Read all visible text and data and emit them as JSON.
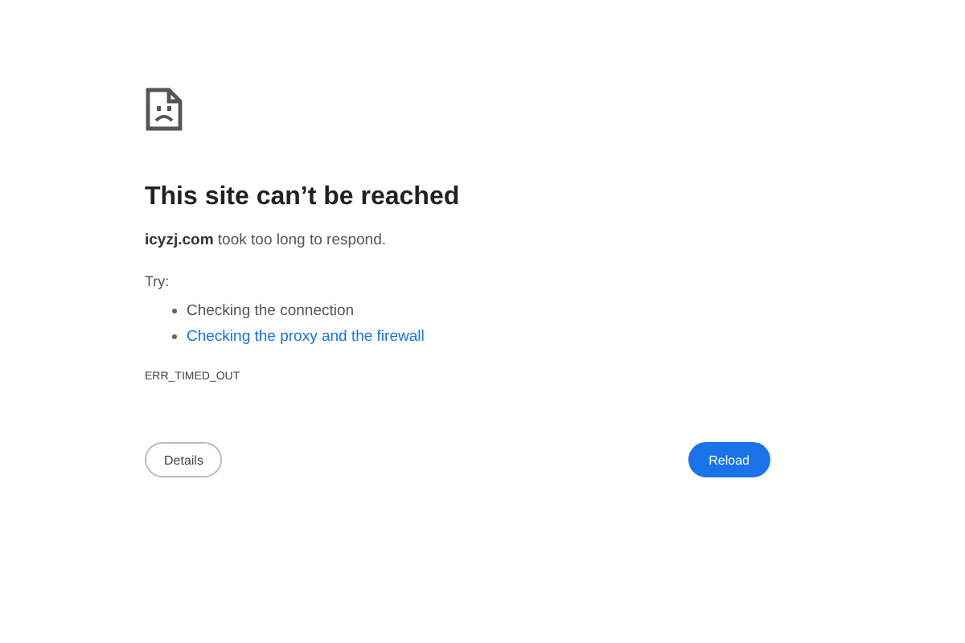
{
  "title": "This site can’t be reached",
  "message": "**icyzj.com** took too long to respond.",
  "try_label": "Try:",
  "suggestions": [
    {
      "kind": "text",
      "label": "Checking the connection"
    },
    {
      "kind": "link",
      "label": "Checking the proxy and the firewall"
    }
  ],
  "error_code": "ERR_TIMED_OUT",
  "buttons": [
    {
      "kind": "secondary",
      "label": "Details"
    },
    {
      "kind": "primary",
      "label": "Reload"
    }
  ]
}
